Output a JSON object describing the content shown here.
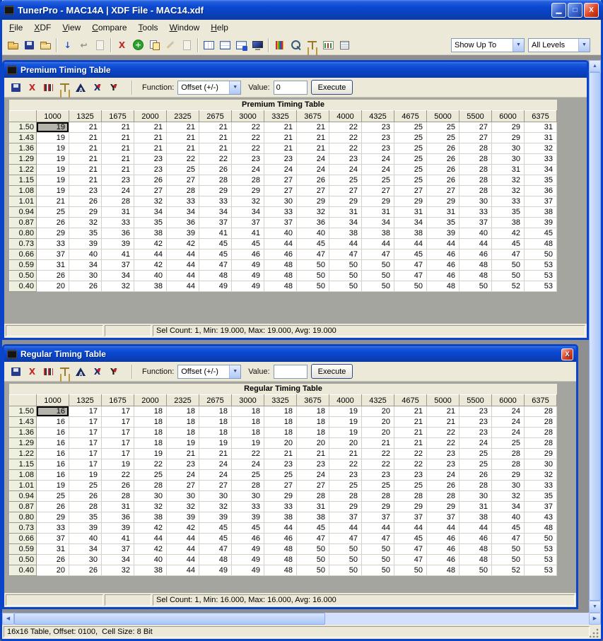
{
  "window": {
    "title": "TunerPro - MAC14A | XDF File - MAC14.xdf",
    "controls": {
      "minimize": "▁",
      "restore": "□",
      "close": "X"
    }
  },
  "menu": {
    "items": [
      "File",
      "XDF",
      "View",
      "Compare",
      "Tools",
      "Window",
      "Help"
    ]
  },
  "icons": {
    "combo_arrow": "▼",
    "up_arrow": "▲",
    "down_arrow": "▼",
    "left_arrow": "◀",
    "right_arrow": "▶"
  },
  "main_toolbar": {
    "show_up_to": "Show Up To",
    "all_levels": "All Levels",
    "buttons": [
      {
        "name": "open-icon",
        "cls": "i-folder"
      },
      {
        "name": "save-icon",
        "cls": "i-save"
      },
      {
        "name": "save-copy-icon",
        "cls": "i-folder f2"
      },
      {
        "sep": true
      },
      {
        "name": "import-icon",
        "cls": "i-gl g-blue",
        "glyph": "↓"
      },
      {
        "name": "undo-icon",
        "cls": "i-gl g-dark dim",
        "glyph": "↩"
      },
      {
        "name": "new-page-icon",
        "cls": "i-page dim"
      },
      {
        "sep": true
      },
      {
        "name": "delete-icon",
        "cls": "i-gl g-red",
        "glyph": "X"
      },
      {
        "name": "add-icon",
        "cls": "i-add",
        "glyph": "+"
      },
      {
        "name": "copy-icon",
        "cls": "i-pagecopy"
      },
      {
        "name": "edit-icon",
        "cls": "i-pencil dim"
      },
      {
        "name": "page-icon",
        "cls": "i-page dim"
      },
      {
        "sep": true
      },
      {
        "name": "list-view-icon",
        "cls": "i-tableV"
      },
      {
        "name": "detail-view-icon",
        "cls": "i-tableH"
      },
      {
        "name": "grid-view-icon",
        "cls": "i-tableC"
      },
      {
        "name": "monitor-icon",
        "cls": "i-monitor"
      },
      {
        "sep": true
      },
      {
        "name": "trace-icon",
        "cls": "i-bars"
      },
      {
        "name": "search-icon",
        "cls": "i-mag"
      },
      {
        "name": "compare-icon",
        "cls": "i-scales"
      },
      {
        "name": "chart-icon",
        "cls": "i-chart"
      },
      {
        "name": "report-icon",
        "cls": "i-report"
      }
    ]
  },
  "table_toolbar": {
    "buttons": [
      {
        "name": "save-icon",
        "cls": "i-save"
      },
      {
        "name": "delete-icon",
        "cls": "i-gl g-red",
        "glyph": "X"
      },
      {
        "name": "hex-view-icon",
        "cls": "i-hex"
      },
      {
        "name": "compare-icon",
        "cls": "i-scales"
      },
      {
        "name": "graph-icon",
        "cls": "i-graph"
      },
      {
        "name": "x-axis-icon",
        "cls": "i-gl g-navy axmark",
        "glyph": "X"
      },
      {
        "name": "y-axis-icon",
        "cls": "i-gl g-dark axmark",
        "glyph": "Y"
      }
    ]
  },
  "premium_window": {
    "title": "Premium Timing Table",
    "function_label": "Function:",
    "function_value": "Offset (+/-)",
    "value_label": "Value:",
    "value_text": "0",
    "execute_label": "Execute",
    "status": "Sel Count: 1, Min: 19.000, Max: 19.000, Avg: 19.000",
    "grid": {
      "title": "Premium Timing Table",
      "col_headers": [
        "1000",
        "1325",
        "1675",
        "2000",
        "2325",
        "2675",
        "3000",
        "3325",
        "3675",
        "4000",
        "4325",
        "4675",
        "5000",
        "5500",
        "6000",
        "6375"
      ],
      "row_headers": [
        "1.50",
        "1.43",
        "1.36",
        "1.29",
        "1.22",
        "1.15",
        "1.08",
        "1.01",
        "0.94",
        "0.87",
        "0.80",
        "0.73",
        "0.66",
        "0.59",
        "0.50",
        "0.40"
      ],
      "selected": {
        "row": 0,
        "col": 0
      },
      "rows": [
        [
          19,
          21,
          21,
          21,
          21,
          21,
          22,
          21,
          21,
          22,
          23,
          25,
          25,
          27,
          29,
          31
        ],
        [
          19,
          21,
          21,
          21,
          21,
          21,
          22,
          21,
          21,
          22,
          23,
          25,
          25,
          27,
          29,
          31
        ],
        [
          19,
          21,
          21,
          21,
          21,
          21,
          22,
          21,
          21,
          22,
          23,
          25,
          26,
          28,
          30,
          32
        ],
        [
          19,
          21,
          21,
          23,
          22,
          22,
          23,
          23,
          24,
          23,
          24,
          25,
          26,
          28,
          30,
          33
        ],
        [
          19,
          21,
          21,
          23,
          25,
          26,
          24,
          24,
          24,
          24,
          24,
          25,
          26,
          28,
          31,
          34
        ],
        [
          19,
          21,
          23,
          26,
          27,
          28,
          28,
          27,
          26,
          25,
          25,
          25,
          26,
          28,
          32,
          35
        ],
        [
          19,
          23,
          24,
          27,
          28,
          29,
          29,
          27,
          27,
          27,
          27,
          27,
          27,
          28,
          32,
          36
        ],
        [
          21,
          26,
          28,
          32,
          33,
          33,
          32,
          30,
          29,
          29,
          29,
          29,
          29,
          30,
          33,
          37
        ],
        [
          25,
          29,
          31,
          34,
          34,
          34,
          34,
          33,
          32,
          31,
          31,
          31,
          31,
          33,
          35,
          38
        ],
        [
          26,
          32,
          33,
          35,
          36,
          37,
          37,
          37,
          36,
          34,
          34,
          34,
          35,
          37,
          38,
          39
        ],
        [
          29,
          35,
          36,
          38,
          39,
          41,
          41,
          40,
          40,
          38,
          38,
          38,
          39,
          40,
          42,
          45
        ],
        [
          33,
          39,
          39,
          42,
          42,
          45,
          45,
          44,
          45,
          44,
          44,
          44,
          44,
          44,
          45,
          48
        ],
        [
          37,
          40,
          41,
          44,
          44,
          45,
          46,
          46,
          47,
          47,
          47,
          45,
          46,
          46,
          47,
          50
        ],
        [
          31,
          34,
          37,
          42,
          44,
          47,
          49,
          48,
          50,
          50,
          50,
          47,
          46,
          48,
          50,
          53
        ],
        [
          26,
          30,
          34,
          40,
          44,
          48,
          49,
          48,
          50,
          50,
          50,
          47,
          46,
          48,
          50,
          53
        ],
        [
          20,
          26,
          32,
          38,
          44,
          49,
          49,
          48,
          50,
          50,
          50,
          50,
          48,
          50,
          52,
          53
        ]
      ]
    }
  },
  "regular_window": {
    "title": "Regular Timing Table",
    "function_label": "Function:",
    "function_value": "Offset (+/-)",
    "value_label": "Value:",
    "value_text": "",
    "execute_label": "Execute",
    "status": "Sel Count: 1, Min: 16.000, Max: 16.000, Avg: 16.000",
    "grid": {
      "title": "Regular Timing Table",
      "col_headers": [
        "1000",
        "1325",
        "1675",
        "2000",
        "2325",
        "2675",
        "3000",
        "3325",
        "3675",
        "4000",
        "4325",
        "4675",
        "5000",
        "5500",
        "6000",
        "6375"
      ],
      "row_headers": [
        "1.50",
        "1.43",
        "1.36",
        "1.29",
        "1.22",
        "1.15",
        "1.08",
        "1.01",
        "0.94",
        "0.87",
        "0.80",
        "0.73",
        "0.66",
        "0.59",
        "0.50",
        "0.40"
      ],
      "selected": {
        "row": 0,
        "col": 0
      },
      "rows": [
        [
          16,
          17,
          17,
          18,
          18,
          18,
          18,
          18,
          18,
          19,
          20,
          21,
          21,
          23,
          24,
          28
        ],
        [
          16,
          17,
          17,
          18,
          18,
          18,
          18,
          18,
          18,
          19,
          20,
          21,
          21,
          23,
          24,
          28
        ],
        [
          16,
          17,
          17,
          18,
          18,
          18,
          18,
          18,
          18,
          19,
          20,
          21,
          22,
          23,
          24,
          28
        ],
        [
          16,
          17,
          17,
          18,
          19,
          19,
          19,
          20,
          20,
          20,
          21,
          21,
          22,
          24,
          25,
          28
        ],
        [
          16,
          17,
          17,
          19,
          21,
          21,
          22,
          21,
          21,
          21,
          22,
          22,
          23,
          25,
          28,
          29
        ],
        [
          16,
          17,
          19,
          22,
          23,
          24,
          24,
          23,
          23,
          22,
          22,
          22,
          23,
          25,
          28,
          30
        ],
        [
          16,
          19,
          22,
          25,
          24,
          24,
          25,
          25,
          24,
          23,
          23,
          23,
          24,
          26,
          29,
          32
        ],
        [
          19,
          25,
          26,
          28,
          27,
          27,
          28,
          27,
          27,
          25,
          25,
          25,
          26,
          28,
          30,
          33
        ],
        [
          25,
          26,
          28,
          30,
          30,
          30,
          30,
          29,
          28,
          28,
          28,
          28,
          28,
          30,
          32,
          35
        ],
        [
          26,
          28,
          31,
          32,
          32,
          32,
          33,
          33,
          31,
          29,
          29,
          29,
          29,
          31,
          34,
          37
        ],
        [
          29,
          35,
          36,
          38,
          39,
          39,
          39,
          38,
          38,
          37,
          37,
          37,
          37,
          38,
          40,
          43
        ],
        [
          33,
          39,
          39,
          42,
          42,
          45,
          45,
          44,
          45,
          44,
          44,
          44,
          44,
          44,
          45,
          48
        ],
        [
          37,
          40,
          41,
          44,
          44,
          45,
          46,
          46,
          47,
          47,
          47,
          45,
          46,
          46,
          47,
          50
        ],
        [
          31,
          34,
          37,
          42,
          44,
          47,
          49,
          48,
          50,
          50,
          50,
          47,
          46,
          48,
          50,
          53
        ],
        [
          26,
          30,
          34,
          40,
          44,
          48,
          49,
          48,
          50,
          50,
          50,
          47,
          46,
          48,
          50,
          53
        ],
        [
          20,
          26,
          32,
          38,
          44,
          49,
          49,
          48,
          50,
          50,
          50,
          50,
          48,
          50,
          52,
          53
        ]
      ]
    }
  },
  "statusbar": {
    "text": "16x16 Table, Offset: 0100,  Cell Size: 8 Bit"
  },
  "colors": {
    "titlebar_blue": "#0A44C8",
    "toolbar_bg": "#ECE9D8",
    "mdi_bg": "#8F8F8F",
    "row_header_bg": "#EEF0DF",
    "selected_cell_bg": "#B4B4AC",
    "close_button_red": "#E04A2A"
  }
}
